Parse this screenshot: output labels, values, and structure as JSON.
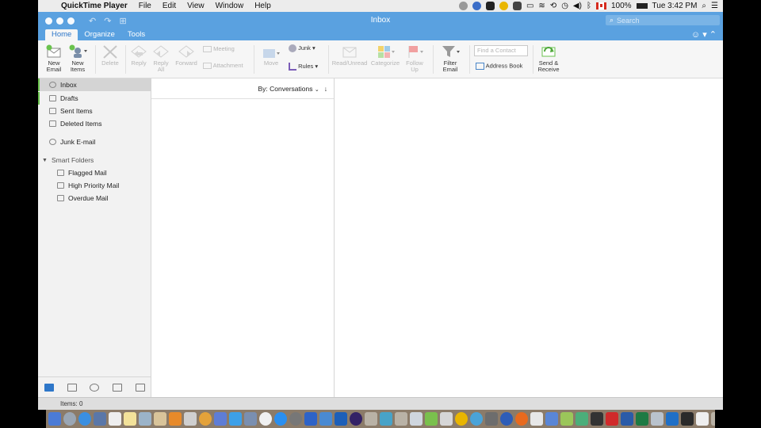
{
  "menubar": {
    "app_name": "QuickTime Player",
    "menus": [
      "File",
      "Edit",
      "View",
      "Window",
      "Help"
    ],
    "battery": "100%",
    "clock": "Tue 3:42 PM"
  },
  "window": {
    "title": "Inbox",
    "search_placeholder": "Search",
    "tabs": [
      "Home",
      "Organize",
      "Tools"
    ]
  },
  "ribbon": {
    "new_email": "New Email",
    "new_items": "New Items",
    "delete": "Delete",
    "reply": "Reply",
    "reply_all": "Reply All",
    "forward": "Forward",
    "meeting": "Meeting",
    "attachment": "Attachment",
    "move": "Move",
    "junk": "Junk",
    "rules": "Rules",
    "read_unread": "Read/Unread",
    "categorize": "Categorize",
    "follow_up": "Follow Up",
    "filter_email": "Filter Email",
    "find_contact_placeholder": "Find a Contact",
    "address_book": "Address Book",
    "send_receive": "Send & Receive"
  },
  "folders": {
    "items": [
      "Inbox",
      "Drafts",
      "Sent Items",
      "Deleted Items",
      "Junk E-mail"
    ],
    "smart_header": "Smart Folders",
    "smart_items": [
      "Flagged Mail",
      "High Priority Mail",
      "Overdue Mail"
    ]
  },
  "message_list": {
    "sort_label": "By: Conversations"
  },
  "status": {
    "items": "Items: 0"
  },
  "colors": {
    "titlebar": "#5aa1e0",
    "accent": "#2e77c9",
    "folder_marker": "#6ac24d"
  }
}
